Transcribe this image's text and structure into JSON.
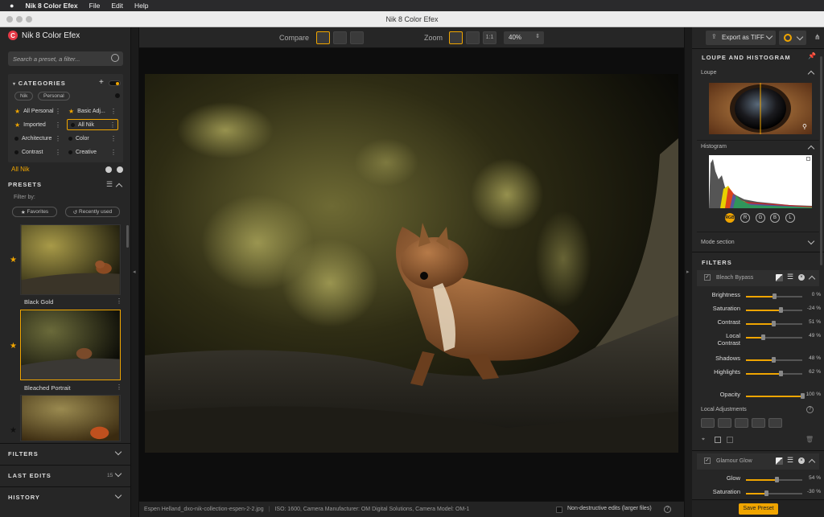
{
  "menubar": {
    "app": "Nik 8 Color Efex",
    "items": [
      "File",
      "Edit",
      "Help"
    ]
  },
  "window": {
    "title": "Nik 8 Color Efex"
  },
  "sidebar": {
    "logo": "Nik 8 Color Efex",
    "search_placeholder": "Search a preset, a filter...",
    "categories_title": "CATEGORIES",
    "filter_pills": [
      "Nik",
      "Personal"
    ],
    "categories": [
      {
        "label": "All Personal",
        "star": true
      },
      {
        "label": "Basic Adj...",
        "star": true
      },
      {
        "label": "Imported",
        "star": true
      },
      {
        "label": "All Nik",
        "star": false
      },
      {
        "label": "Architecture",
        "star": false
      },
      {
        "label": "Color",
        "star": false
      },
      {
        "label": "Contrast",
        "star": false
      },
      {
        "label": "Creative",
        "star": false
      }
    ],
    "current": "All Nik",
    "presets_title": "PRESETS",
    "filter_by": "Filter by:",
    "favorites": "Favorites",
    "recently_used": "Recently used",
    "presets": [
      {
        "label": "Black Gold"
      },
      {
        "label": "Bleached Portrait"
      }
    ],
    "sections": {
      "filters": "FILTERS",
      "last_edits": "LAST EDITS",
      "last_edits_count": "15",
      "history": "HISTORY"
    }
  },
  "toolbar": {
    "compare": "Compare",
    "zoom": "Zoom",
    "one_to_one": "1:1",
    "zoom_value": "40%"
  },
  "status": {
    "file": "Espen Helland_dxo-nik-collection-espen-2-2.jpg",
    "meta": "ISO: 1600, Camera Manufacturer: OM Digital Solutions, Camera Model: OM-1",
    "nondestructive": "Non-destructive edits (larger files)"
  },
  "right": {
    "export": "Export as TIFF",
    "loupe_title": "LOUPE AND HISTOGRAM",
    "loupe": "Loupe",
    "histogram": "Histogram",
    "channels": [
      "RGB",
      "R",
      "G",
      "B",
      "L"
    ],
    "mode_section": "Mode section",
    "filters_title": "FILTERS",
    "filter1": {
      "name": "Bleach Bypass",
      "sliders": [
        {
          "label": "Brightness",
          "value": "0 %",
          "pos": 0.5
        },
        {
          "label": "Saturation",
          "value": "-24 %",
          "pos": 0.62
        },
        {
          "label": "Contrast",
          "value": "51 %",
          "pos": 0.48
        },
        {
          "label": "Local Contrast",
          "value": "49 %",
          "pos": 0.3
        },
        {
          "label": "Shadows",
          "value": "48 %",
          "pos": 0.48
        },
        {
          "label": "Highlights",
          "value": "62 %",
          "pos": 0.62
        },
        {
          "label": "Opacity",
          "value": "100 %",
          "pos": 1.0
        }
      ]
    },
    "local_adjustments": "Local Adjustments",
    "filter2": {
      "name": "Glamour Glow",
      "sliders": [
        {
          "label": "Glow",
          "value": "54 %",
          "pos": 0.54
        },
        {
          "label": "Saturation",
          "value": "-30 %",
          "pos": 0.35
        }
      ]
    },
    "save_preset": "Save Preset"
  },
  "colors": {
    "accent": "#f0a500",
    "panel": "#262626"
  }
}
